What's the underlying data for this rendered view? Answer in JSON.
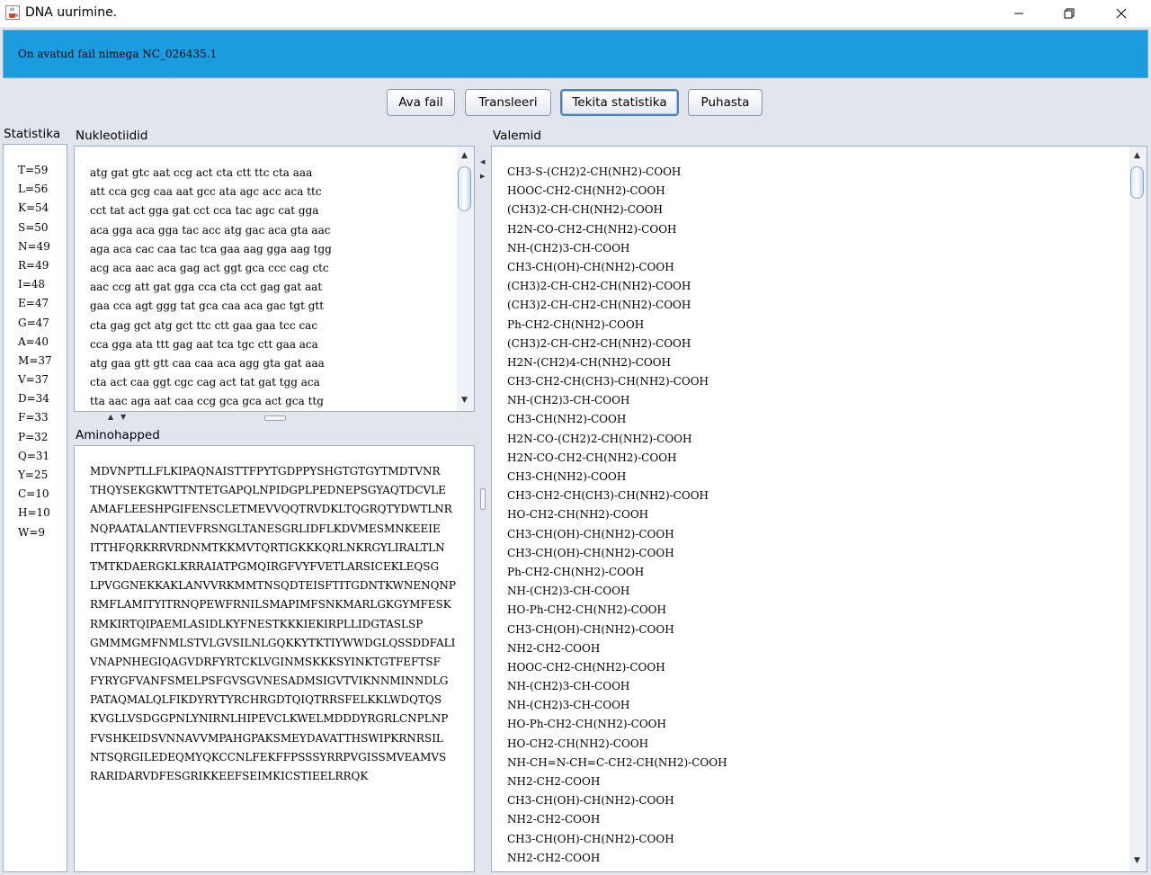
{
  "window": {
    "title": "DNA uurimine.",
    "controls": {
      "minimize": "—",
      "maximize": "❐",
      "close": "✕"
    }
  },
  "status": {
    "message": "On avatud fail nimega NC_026435.1"
  },
  "toolbar": {
    "open_label": "Ava fail",
    "translate_label": "Transleeri",
    "stats_label": "Tekita statistika",
    "clear_label": "Puhasta"
  },
  "statistics": {
    "title": "Statistika",
    "items": [
      "T=59",
      "L=56",
      "K=54",
      "S=50",
      "N=49",
      "R=49",
      "I=48",
      "E=47",
      "G=47",
      "A=40",
      "M=37",
      "V=37",
      "D=34",
      "F=33",
      "P=32",
      "Q=31",
      "Y=25",
      "C=10",
      "H=10",
      "W=9"
    ]
  },
  "nucleotides": {
    "title": "Nukleotiidid",
    "lines": [
      "atg gat gtc aat ccg act cta ctt ttc cta aaa",
      "att cca gcg caa aat gcc ata agc acc aca ttc",
      "cct tat act gga gat cct cca tac agc cat gga",
      "aca gga aca gga tac acc atg gac aca gta aac",
      "aga aca cac caa tac tca gaa aag gga aag tgg",
      "acg aca aac aca gag act ggt gca ccc cag ctc",
      "aac ccg att gat gga cca cta cct gag gat aat",
      "gaa cca agt ggg tat gca caa aca gac tgt gtt",
      "cta gag gct atg gct ttc ctt gaa gaa tcc cac",
      "cca gga ata ttt gag aat tca tgc ctt gaa aca",
      "atg gaa gtt gtt caa caa aca agg gta gat aaa",
      "cta act caa ggt cgc cag act tat gat tgg aca",
      "tta aac aga aat caa ccg gca gca act gca ttg"
    ]
  },
  "amino_acids": {
    "title": "Aminohapped",
    "lines": [
      "MDVNPTLLFLKIPAQNAISTTFPYTGDPPYSHGTGTGYTMDTVNR",
      "THQYSEKGKWTTNTETGAPQLNPIDGPLPEDNEPSGYAQTDCVLE",
      "AMAFLEESHPGIFENSCLETMEVVQQTRVDKLTQGRQTYDWTLNR",
      "NQPAATALANTIEVFRSNGLTANESGRLIDFLKDVMESMNKEEIE",
      "ITTHFQRKRRVRDNMTKKMVTQRTIGKKKQRLNKRGYLIRALTLN",
      "TMTKDAERGKLKRRAIATPGMQIRGFVYFVETLARSICEKLEQSG",
      "LPVGGNEKKAKLANVVRKMMTNSQDTEISFTITGDNTKWNENQNP",
      "RMFLAMITYITRNQPEWFRNILSMAPIMFSNKMARLGKGYMFESK",
      "RMKIRTQIPAEMLASIDLKYFNESTKKKIEKIRPLLIDGTASLSP",
      "GMMMGMFNMLSTVLGVSILNLGQKKYTKTIYWWDGLQSSDDFALI",
      "VNAPNHEGIQAGVDRFYRTCKLVGINMSKKKSYINKTGTFEFTSF",
      "FYRYGFVANFSMELPSFGVSGVNESADMSIGVTVIKNNMINNDLG",
      "PATAQMALQLFIKDYRYTYRCHRGDTQIQTRRSFELKKLWDQTQS",
      "KVGLLVSDGGPNLYNIRNLHIPEVCLKWELMDDDYRGRLCNPLNP",
      "FVSHKEIDSVNNAVVMPAHGPAKSMEYDAVATTHSWIPKRNRSIL",
      "NTSQRGILEDEQMYQKCCNLFEKFFPSSSYRRPVGISSMVEAMVS",
      "RARIDARVDFESGRIKKEEFSEIMKICSTIEELRRQK"
    ]
  },
  "formulas": {
    "title": "Valemid",
    "lines": [
      "CH3-S-(CH2)2-CH(NH2)-COOH",
      "HOOC-CH2-CH(NH2)-COOH",
      "(CH3)2-CH-CH(NH2)-COOH",
      "H2N-CO-CH2-CH(NH2)-COOH",
      "NH-(CH2)3-CH-COOH",
      "CH3-CH(OH)-CH(NH2)-COOH",
      "(CH3)2-CH-CH2-CH(NH2)-COOH",
      "(CH3)2-CH-CH2-CH(NH2)-COOH",
      "Ph-CH2-CH(NH2)-COOH",
      "(CH3)2-CH-CH2-CH(NH2)-COOH",
      "H2N-(CH2)4-CH(NH2)-COOH",
      "CH3-CH2-CH(CH3)-CH(NH2)-COOH",
      "NH-(CH2)3-CH-COOH",
      "CH3-CH(NH2)-COOH",
      "H2N-CO-(CH2)2-CH(NH2)-COOH",
      "H2N-CO-CH2-CH(NH2)-COOH",
      "CH3-CH(NH2)-COOH",
      "CH3-CH2-CH(CH3)-CH(NH2)-COOH",
      "HO-CH2-CH(NH2)-COOH",
      "CH3-CH(OH)-CH(NH2)-COOH",
      "CH3-CH(OH)-CH(NH2)-COOH",
      "Ph-CH2-CH(NH2)-COOH",
      "NH-(CH2)3-CH-COOH",
      "HO-Ph-CH2-CH(NH2)-COOH",
      "CH3-CH(OH)-CH(NH2)-COOH",
      "NH2-CH2-COOH",
      "HOOC-CH2-CH(NH2)-COOH",
      "NH-(CH2)3-CH-COOH",
      "NH-(CH2)3-CH-COOH",
      "HO-Ph-CH2-CH(NH2)-COOH",
      "HO-CH2-CH(NH2)-COOH",
      "NH-CH=N-CH=C-CH2-CH(NH2)-COOH",
      "NH2-CH2-COOH",
      "CH3-CH(OH)-CH(NH2)-COOH",
      "NH2-CH2-COOH",
      "CH3-CH(OH)-CH(NH2)-COOH",
      "NH2-CH2-COOH"
    ]
  },
  "icons": {
    "app": "java-coffee-cup-icon",
    "scroll_up": "▲",
    "scroll_down": "▼",
    "split_up": "▲",
    "split_down": "▼"
  },
  "colors": {
    "banner": "#1a9cde",
    "background": "#e1e6ee"
  }
}
